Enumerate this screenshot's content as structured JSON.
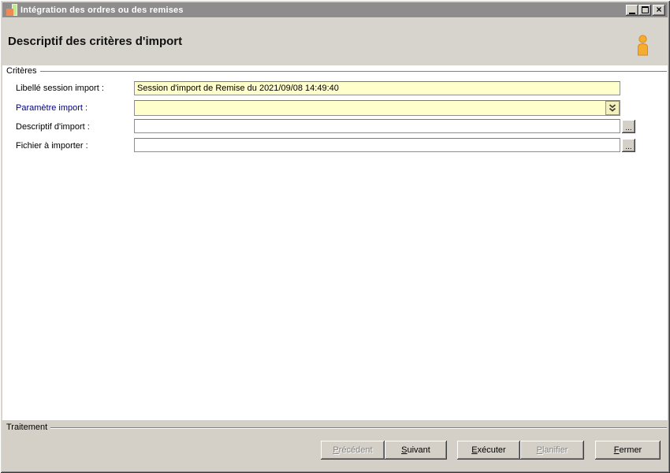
{
  "window": {
    "title": "Intégration des ordres ou des remises",
    "controls": {
      "close_glyph": "×"
    }
  },
  "header": {
    "title": "Descriptif des critères d'import"
  },
  "criteria": {
    "group_label": "Critères",
    "fields": [
      {
        "label": "Libellé session import :",
        "value": "Session d'import de Remise du 2021/09/08 14:49:40",
        "type": "text"
      },
      {
        "label": "Paramètre import :",
        "value": "",
        "type": "dropdown",
        "required": true
      },
      {
        "label": "Descriptif d'import :",
        "value": "",
        "type": "browse",
        "browse_label": "..."
      },
      {
        "label": "Fichier à importer :",
        "value": "",
        "type": "browse",
        "browse_label": "..."
      }
    ]
  },
  "treatment": {
    "group_label": "Traitement"
  },
  "buttons": [
    {
      "label": "Précédent",
      "enabled": false
    },
    {
      "label": "Suivant",
      "enabled": true
    },
    {
      "label": "Exécuter",
      "enabled": true
    },
    {
      "label": "Planifier",
      "enabled": false
    },
    {
      "label": "Fermer",
      "enabled": true
    }
  ],
  "colors": {
    "titlebar": "#8E8C8D",
    "window_gray": "#D4D0C8",
    "header_gray": "#D7D4CD",
    "highlight_field": "#FFFFCC",
    "required_label": "#000080",
    "user_icon_orange": "#F5A623",
    "app_icon_orange": "#EF8A55",
    "app_icon_green": "#C3E793"
  }
}
